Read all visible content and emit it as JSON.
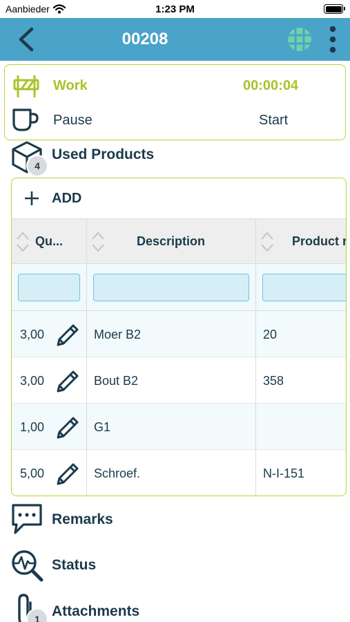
{
  "status_bar": {
    "carrier": "Aanbieder",
    "time": "1:23 PM"
  },
  "nav": {
    "title": "00208",
    "back_icon": "chevron-left-icon",
    "globe_icon": "globe-icon",
    "more_icon": "more-vertical-icon"
  },
  "work": {
    "work_label": "Work",
    "timer": "00:00:04",
    "pause_label": "Pause",
    "start_label": "Start",
    "accent_color": "#a9c32a"
  },
  "used_products": {
    "label": "Used Products",
    "badge": "4",
    "add_label": "ADD",
    "columns": [
      {
        "label": "Qu..."
      },
      {
        "label": "Description"
      },
      {
        "label": "Product r"
      }
    ],
    "rows": [
      {
        "quantity": "3,00",
        "description": "Moer B2",
        "product": "20"
      },
      {
        "quantity": "3,00",
        "description": "Bout B2",
        "product": "358"
      },
      {
        "quantity": "1,00",
        "description": "G1",
        "product": ""
      },
      {
        "quantity": "5,00",
        "description": "Schroef.",
        "product": "N-I-151"
      }
    ]
  },
  "sections": {
    "remarks": "Remarks",
    "status": "Status",
    "attachments": "Attachments",
    "attachments_badge": "1"
  },
  "colors": {
    "nav_bg": "#4aa3c9",
    "primary_text": "#1b3a4b",
    "border_accent": "#b9d33a"
  }
}
